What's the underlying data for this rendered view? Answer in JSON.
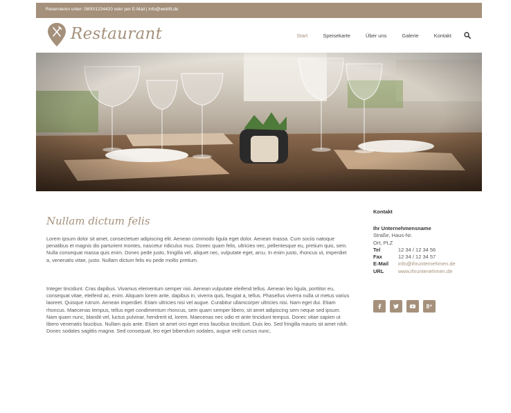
{
  "topbar": {
    "text": "Reservieren unter: 0800/1234420 oder per E-Mail  |  info@webfit.de"
  },
  "brand": {
    "name": "Restaurant",
    "color": "#a5917b",
    "logo_icon": "fork-knife-pin-icon"
  },
  "nav": {
    "items": [
      {
        "label": "Start",
        "active": true
      },
      {
        "label": "Speisekarte",
        "active": false
      },
      {
        "label": "Über uns",
        "active": false
      },
      {
        "label": "Galerie",
        "active": false
      },
      {
        "label": "Kontakt",
        "active": false
      }
    ],
    "search_icon": "search-icon"
  },
  "hero": {
    "image": "restaurant-table-with-wine-glasses-photo"
  },
  "main": {
    "title": "Nullam dictum felis",
    "paragraphs": [
      "Lorem ipsum dolor sit amet, consectetuer adipiscing elit. Aenean commodo ligula eget dolor. Aenean massa. Cum sociis natoque penatibus et magnis dis parturient montes, nascetur ridiculus mus. Donec quam felis, ultricies nec, pellentesque eu, pretium quis, sem. Nulla consequat massa quis enim. Donec pede justo, fringilla vel, aliquet nec, vulputate eget, arcu. In enim justo, rhoncus ut, imperdiet a, venenatis vitae, justo. Nullam dictum felis eu pede mollis pretium.",
      "Integer tincidunt. Cras dapibus. Vivamus elementum semper nisi. Aenean vulputate eleifend tellus. Aenean leo ligula, porttitor eu, consequat vitae, eleifend ac, enim. Aliquam lorem ante, dapibus in, viverra quis, feugiat a, tellus. Phasellus viverra nulla ut metus varius laoreet. Quisque rutrum. Aenean imperdiet. Etiam ultricies nisi vel augue. Curabitur ullamcorper ultricies nisi. Nam eget dui. Etiam rhoncus. Maecenas tempus, tellus eget condimentum rhoncus, sem quam semper libero, sit amet adipiscing sem neque sed ipsum. Nam quam nunc, blandit vel, luctus pulvinar, hendrerit id, lorem. Maecenas nec odio et ante tincidunt tempus. Donec vitae sapien ut libero venenatis faucibus. Nullam quis ante. Etiam sit amet orci eget eros faucibus tincidunt. Duis leo. Sed fringilla mauris sit amet nibh. Donec sodales sagittis magna. Sed consequat, leo eget bibendum sodales, augue velit cursus nunc,"
    ]
  },
  "sidebar": {
    "title": "Kontakt",
    "company": "Ihr Unternehmensname",
    "street": "Straße, Haus-Nr.",
    "city": "Ort, PLZ",
    "tel_label": "Tel",
    "tel": "12 34 / 12 34 56",
    "fax_label": "Fax",
    "fax": "12 34 / 12 34 57",
    "email_label": "E-Mail",
    "email": "info@ihrunternehmen.de",
    "url_label": "URL",
    "url": "www.ihruntenehmen.de",
    "social": [
      {
        "name": "facebook-icon"
      },
      {
        "name": "twitter-icon"
      },
      {
        "name": "youtube-icon"
      },
      {
        "name": "google-plus-icon",
        "label": "8⁺"
      }
    ]
  }
}
